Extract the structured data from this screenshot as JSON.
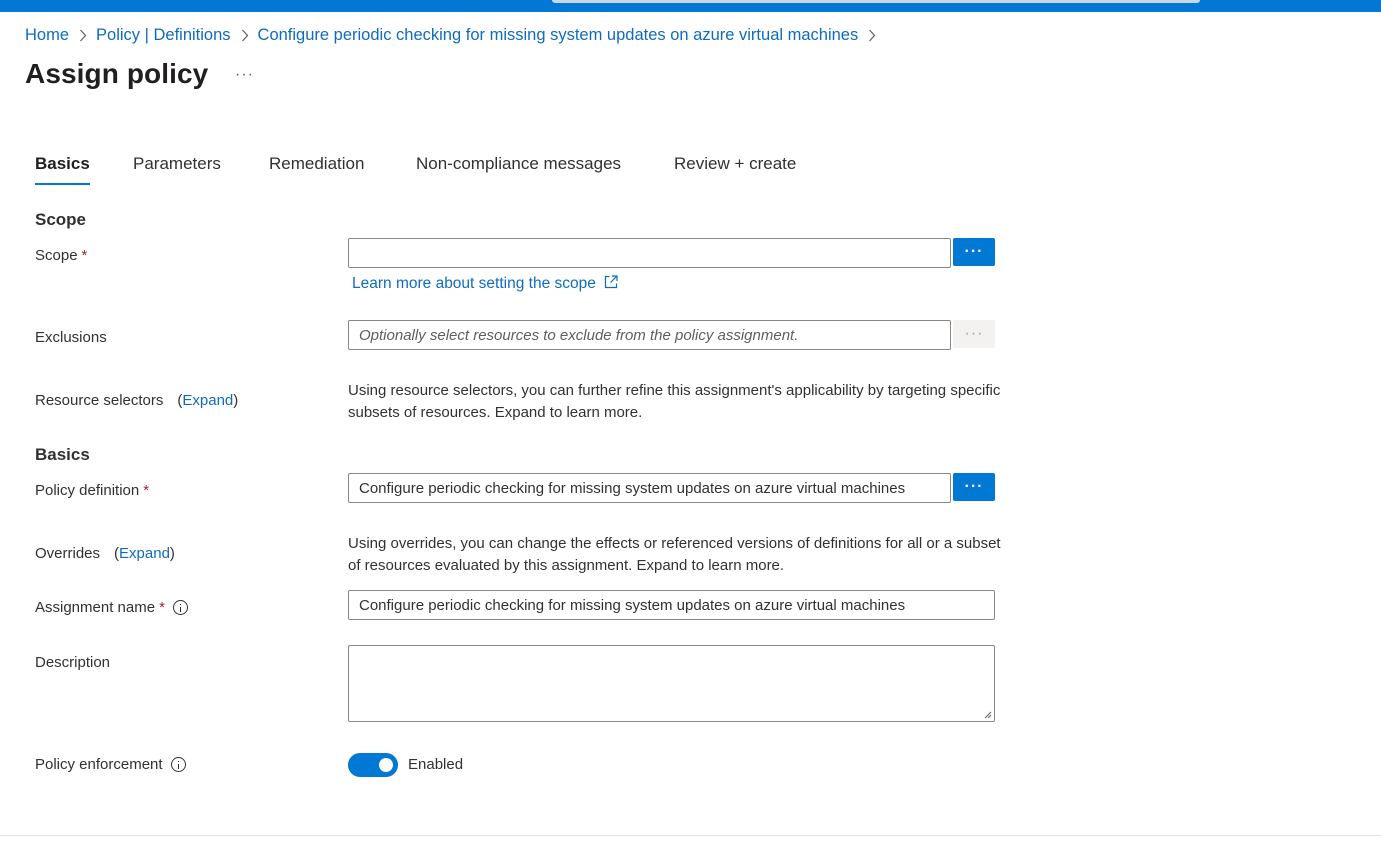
{
  "breadcrumb": {
    "items": [
      "Home",
      "Policy | Definitions",
      "Configure periodic checking for missing system updates on azure virtual machines"
    ]
  },
  "header": {
    "title": "Assign policy",
    "more": "···"
  },
  "tabs": [
    {
      "label": "Basics",
      "active": true
    },
    {
      "label": "Parameters",
      "active": false
    },
    {
      "label": "Remediation",
      "active": false
    },
    {
      "label": "Non-compliance messages",
      "active": false
    },
    {
      "label": "Review + create",
      "active": false
    }
  ],
  "scope_section": {
    "heading": "Scope",
    "scope_label": "Scope",
    "required_mark": "*",
    "scope_value": "",
    "browse_button": "···",
    "learn_more": "Learn more about setting the scope",
    "exclusions_label": "Exclusions",
    "exclusions_placeholder": "Optionally select resources to exclude from the policy assignment.",
    "resource_selectors_label": "Resource selectors",
    "expand": "Expand",
    "open_paren": "(",
    "close_paren": ")",
    "resource_selectors_desc": "Using resource selectors, you can further refine this assignment's applicability by targeting specific subsets of resources. Expand to learn more."
  },
  "basics_section": {
    "heading": "Basics",
    "policy_definition_label": "Policy definition",
    "policy_definition_value": "Configure periodic checking for missing system updates on azure virtual machines",
    "overrides_label": "Overrides",
    "overrides_desc": "Using overrides, you can change the effects or referenced versions of definitions for all or a subset of resources evaluated by this assignment. Expand to learn more.",
    "assignment_name_label": "Assignment name",
    "assignment_name_value": "Configure periodic checking for missing system updates on azure virtual machines",
    "description_label": "Description",
    "description_value": "",
    "policy_enforcement_label": "Policy enforcement",
    "policy_enforcement_value": "Enabled",
    "policy_enforcement_on": true
  },
  "colors": {
    "accent": "#0078d4",
    "link": "#0f6cbd",
    "required": "#a4262c"
  }
}
